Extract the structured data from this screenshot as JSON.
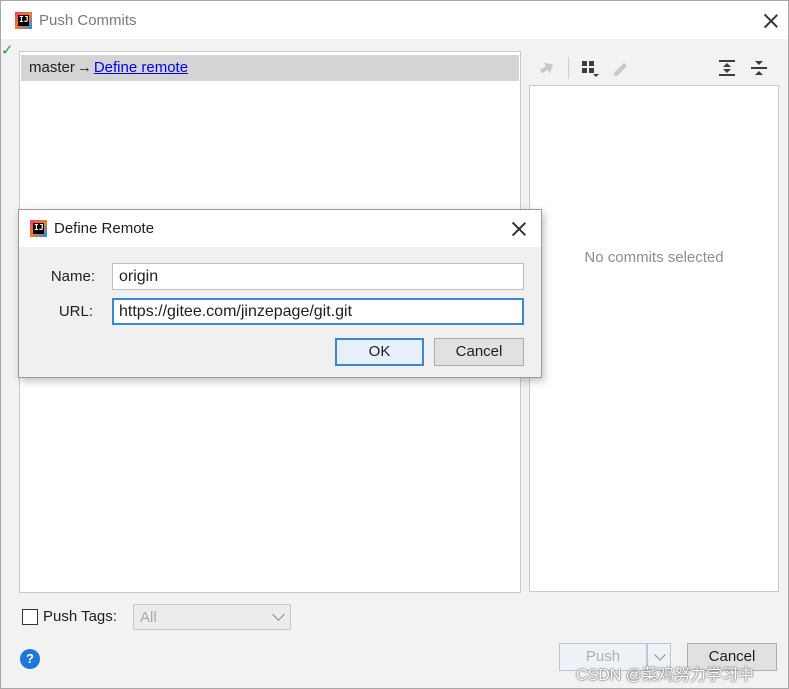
{
  "window": {
    "title": "Push Commits"
  },
  "commits_tree": {
    "branch": "master",
    "arrow": "→",
    "link": "Define remote"
  },
  "details": {
    "empty_text": "No commits selected"
  },
  "dialog": {
    "title": "Define Remote",
    "name_label": "Name:",
    "name_value": "origin",
    "url_label": "URL:",
    "url_value": "https://gitee.com/jinzepage/git.git",
    "ok_label": "OK",
    "cancel_label": "Cancel"
  },
  "footer": {
    "push_tags_label": "Push Tags:",
    "tags_value": "All",
    "push_label": "Push",
    "cancel_label": "Cancel",
    "help_glyph": "?"
  },
  "watermark": "CSDN @菜鸡努力学习中",
  "toolbar": {
    "icons": [
      "cherry-pick-icon",
      "group-by-icon",
      "edit-icon",
      "expand-all-icon",
      "collapse-all-icon"
    ]
  },
  "colors": {
    "accent": "#3d86d4",
    "link": "#0000ee",
    "selected_row": "#d4d4d4",
    "help": "#1f76d6"
  }
}
